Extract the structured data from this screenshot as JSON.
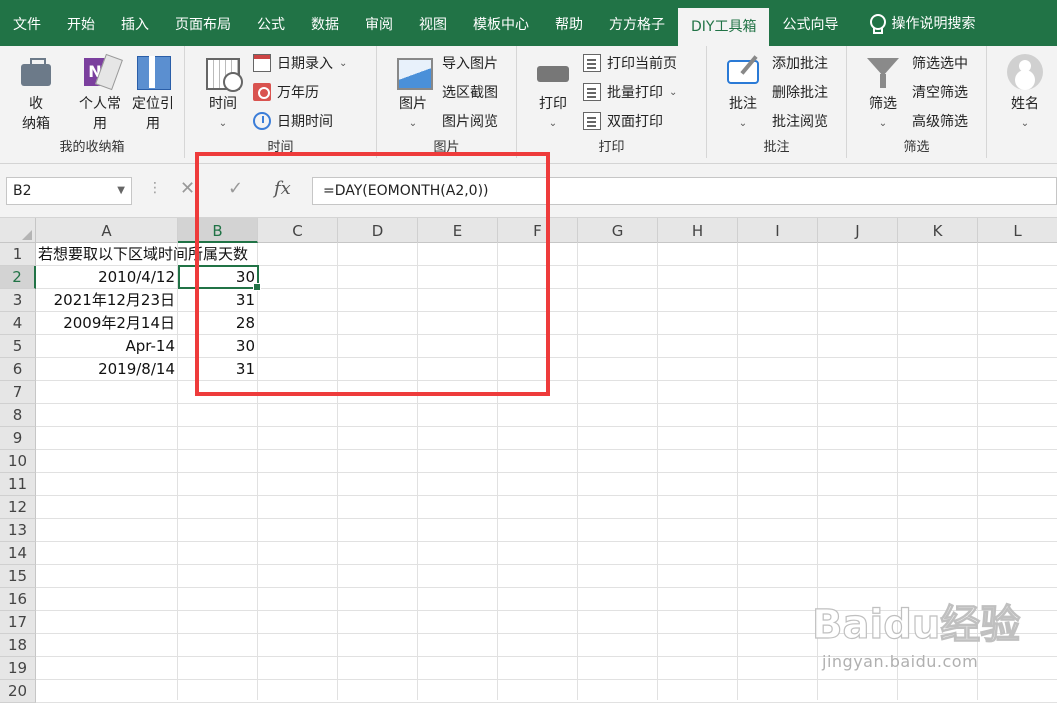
{
  "menubar": {
    "tabs": [
      {
        "label": "文件"
      },
      {
        "label": "开始"
      },
      {
        "label": "插入"
      },
      {
        "label": "页面布局"
      },
      {
        "label": "公式"
      },
      {
        "label": "数据"
      },
      {
        "label": "审阅"
      },
      {
        "label": "视图"
      },
      {
        "label": "模板中心"
      },
      {
        "label": "帮助"
      },
      {
        "label": "方方格子"
      },
      {
        "label": "DIY工具箱",
        "active": true
      },
      {
        "label": "公式向导"
      }
    ],
    "help_text": "操作说明搜索"
  },
  "ribbon": {
    "groups": {
      "favorites": {
        "label": "我的收纳箱",
        "storage_btn": "收\n纳箱",
        "personal_btn": "个人常\n用",
        "locate_btn": "定位引\n用"
      },
      "time": {
        "label": "时间",
        "time_btn": "时间",
        "date_entry": "日期录入",
        "calendar": "万年历",
        "datetime": "日期时间"
      },
      "picture": {
        "label": "图片",
        "picture_btn": "图片",
        "import_pic": "导入图片",
        "region_shot": "选区截图",
        "pic_browse": "图片阅览"
      },
      "print": {
        "label": "打印",
        "print_btn": "打印",
        "print_current": "打印当前页",
        "batch_print": "批量打印",
        "duplex_print": "双面打印"
      },
      "comment": {
        "label": "批注",
        "comment_btn": "批注",
        "add_comment": "添加批注",
        "delete_comment": "删除批注",
        "browse_comment": "批注阅览"
      },
      "filter": {
        "label": "筛选",
        "filter_btn": "筛选",
        "filter_selected": "筛选选中",
        "clear_filter": "清空筛选",
        "advanced_filter": "高级筛选"
      },
      "name": {
        "name_btn": "姓名"
      }
    }
  },
  "formulabar": {
    "namebox": "B2",
    "fx": "fx",
    "formula": "=DAY(EOMONTH(A2,0))"
  },
  "grid": {
    "columns": [
      "A",
      "B",
      "C",
      "D",
      "E",
      "F",
      "G",
      "H",
      "I",
      "J",
      "K",
      "L"
    ],
    "selected_column": "B",
    "rows": [
      "1",
      "2",
      "3",
      "4",
      "5",
      "6",
      "7",
      "8",
      "9",
      "10",
      "11",
      "12",
      "13",
      "14",
      "15",
      "16",
      "17",
      "18",
      "19",
      "20"
    ],
    "selected_row": "2",
    "cells": {
      "A1": "若想要取以下区域时间所属天数",
      "A2": "2010/4/12",
      "B2": "30",
      "A3": "2021年12月23日",
      "B3": "31",
      "A4": "2009年2月14日",
      "B4": "28",
      "A5": "Apr-14",
      "B5": "30",
      "A6": "2019/8/14",
      "B6": "31"
    }
  },
  "watermark": {
    "logo": "Baidu经验",
    "sub": "jingyan.baidu.com"
  }
}
